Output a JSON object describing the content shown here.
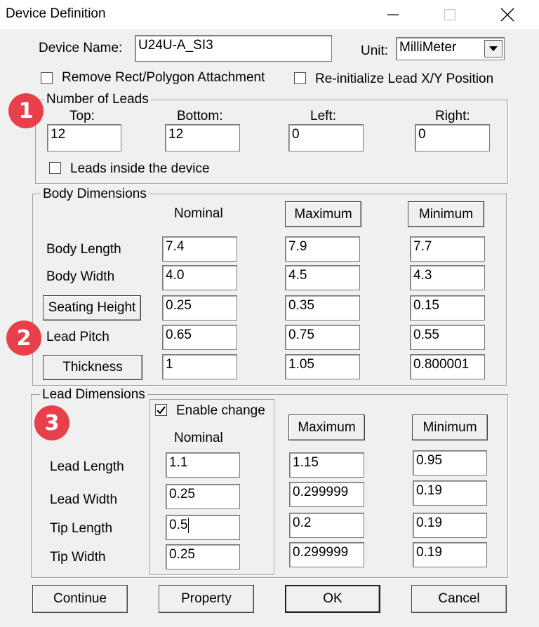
{
  "window": {
    "title": "Device Definition"
  },
  "device": {
    "name_label": "Device Name:",
    "name_value": "U24U-A_SI3",
    "unit_label": "Unit:",
    "unit_value": "MilliMeter"
  },
  "options": {
    "remove_attachment": "Remove Rect/Polygon Attachment",
    "reinit_lead": "Re-initialize Lead X/Y Position"
  },
  "leads": {
    "group_title": "Number of Leads",
    "top_label": "Top:",
    "top_value": "12",
    "bottom_label": "Bottom:",
    "bottom_value": "12",
    "left_label": "Left:",
    "left_value": "0",
    "right_label": "Right:",
    "right_value": "0",
    "inside_label": "Leads inside the device"
  },
  "body": {
    "group_title": "Body Dimensions",
    "nominal_header": "Nominal",
    "maximum_button": "Maximum",
    "minimum_button": "Minimum",
    "rows": [
      {
        "label": "Body Length",
        "nominal": "7.4",
        "max": "7.9",
        "min": "7.7"
      },
      {
        "label": "Body Width",
        "nominal": "4.0",
        "max": "4.5",
        "min": "4.3"
      },
      {
        "label": "Seating Height",
        "nominal": "0.25",
        "max": "0.35",
        "min": "0.15"
      },
      {
        "label": "Lead Pitch",
        "nominal": "0.65",
        "max": "0.75",
        "min": "0.55"
      },
      {
        "label": "Thickness",
        "nominal": "1",
        "max": "1.05",
        "min": "0.800001"
      }
    ]
  },
  "lead_dims": {
    "group_title": "Lead Dimensions",
    "enable_change": "Enable change",
    "nominal_header": "Nominal",
    "maximum_button": "Maximum",
    "minimum_button": "Minimum",
    "rows": [
      {
        "label": "Lead Length",
        "nominal": "1.1",
        "max": "1.15",
        "min": "0.95"
      },
      {
        "label": "Lead Width",
        "nominal": "0.25",
        "max": "0.299999",
        "min": "0.19"
      },
      {
        "label": "Tip Length",
        "nominal": "0.5",
        "max": "0.2",
        "min": "0.19"
      },
      {
        "label": "Tip Width",
        "nominal": "0.25",
        "max": "0.299999",
        "min": "0.19"
      }
    ]
  },
  "buttons": {
    "continue": "Continue",
    "property": "Property",
    "ok": "OK",
    "cancel": "Cancel"
  },
  "annotations": {
    "one": "1",
    "two": "2",
    "three": "3",
    "color": "#e8404a"
  }
}
